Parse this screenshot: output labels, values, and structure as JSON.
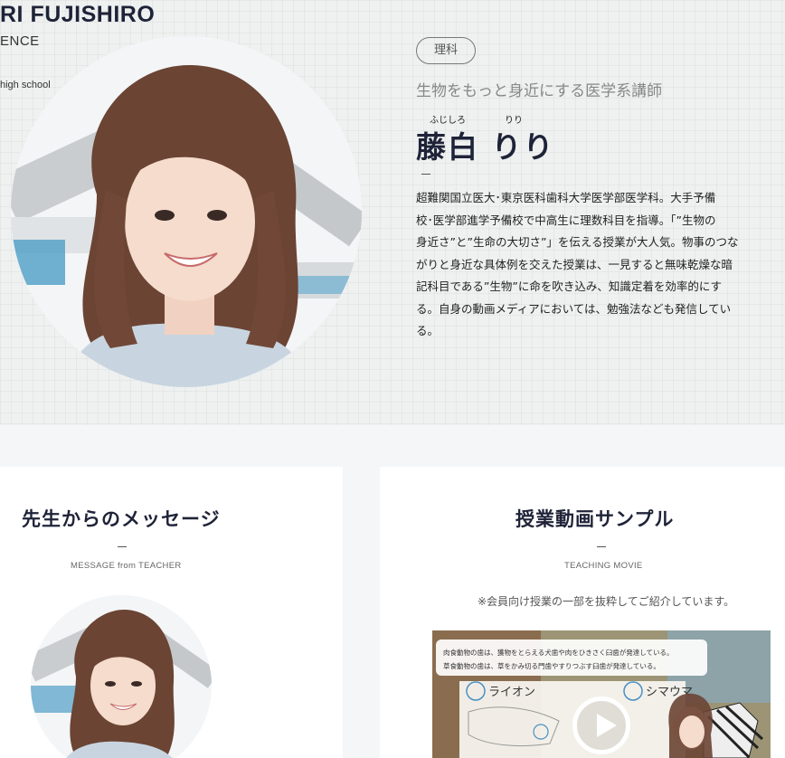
{
  "profile": {
    "name_en": "RI FUJISHIRO",
    "subject_en": "ENCE",
    "school_en": "high school",
    "subject_badge": "理科",
    "tagline": "生物をもっと身近にする医学系講師",
    "ruby_surname": "ふじしろ",
    "ruby_given": "りり",
    "name_ja": "藤白 りり",
    "bio_lines": [
      "超難関国立医大･東京医科歯科大学医学部医学科。大手予備",
      "校･医学部進学予備校で中高生に理数科目を指導。「”生物の",
      "身近さ”と”生命の大切さ”」を伝える授業が大人気。物事のつな",
      "がりと身近な具体例を交えた授業は、一見すると無味乾燥な暗",
      "記科目である”生物”に命を吹き込み、知識定着を効率的にす",
      "る。自身の動画メディアにおいては、勉強法なども発信してい",
      "る。"
    ]
  },
  "message": {
    "title": "先生からのメッセージ",
    "subtitle": "MESSAGE from TEACHER"
  },
  "movie": {
    "title": "授業動画サンプル",
    "subtitle": "TEACHING MOVIE",
    "note": "※会員向け授業の一部を抜粋してご紹介しています。",
    "board_line_1": "肉食動物の歯は、獲物をとらえる犬歯や肉をひきさく臼歯が発達している。",
    "board_line_2": "草食動物の歯は、草をかみ切る門歯やすりつぶす臼歯が発達している。",
    "label_lion": "ライオン",
    "label_zebra": "シマウマ"
  },
  "icons": {
    "play": "play-icon"
  },
  "colors": {
    "heading": "#1f2338",
    "accent_pink": "#e8418a"
  }
}
